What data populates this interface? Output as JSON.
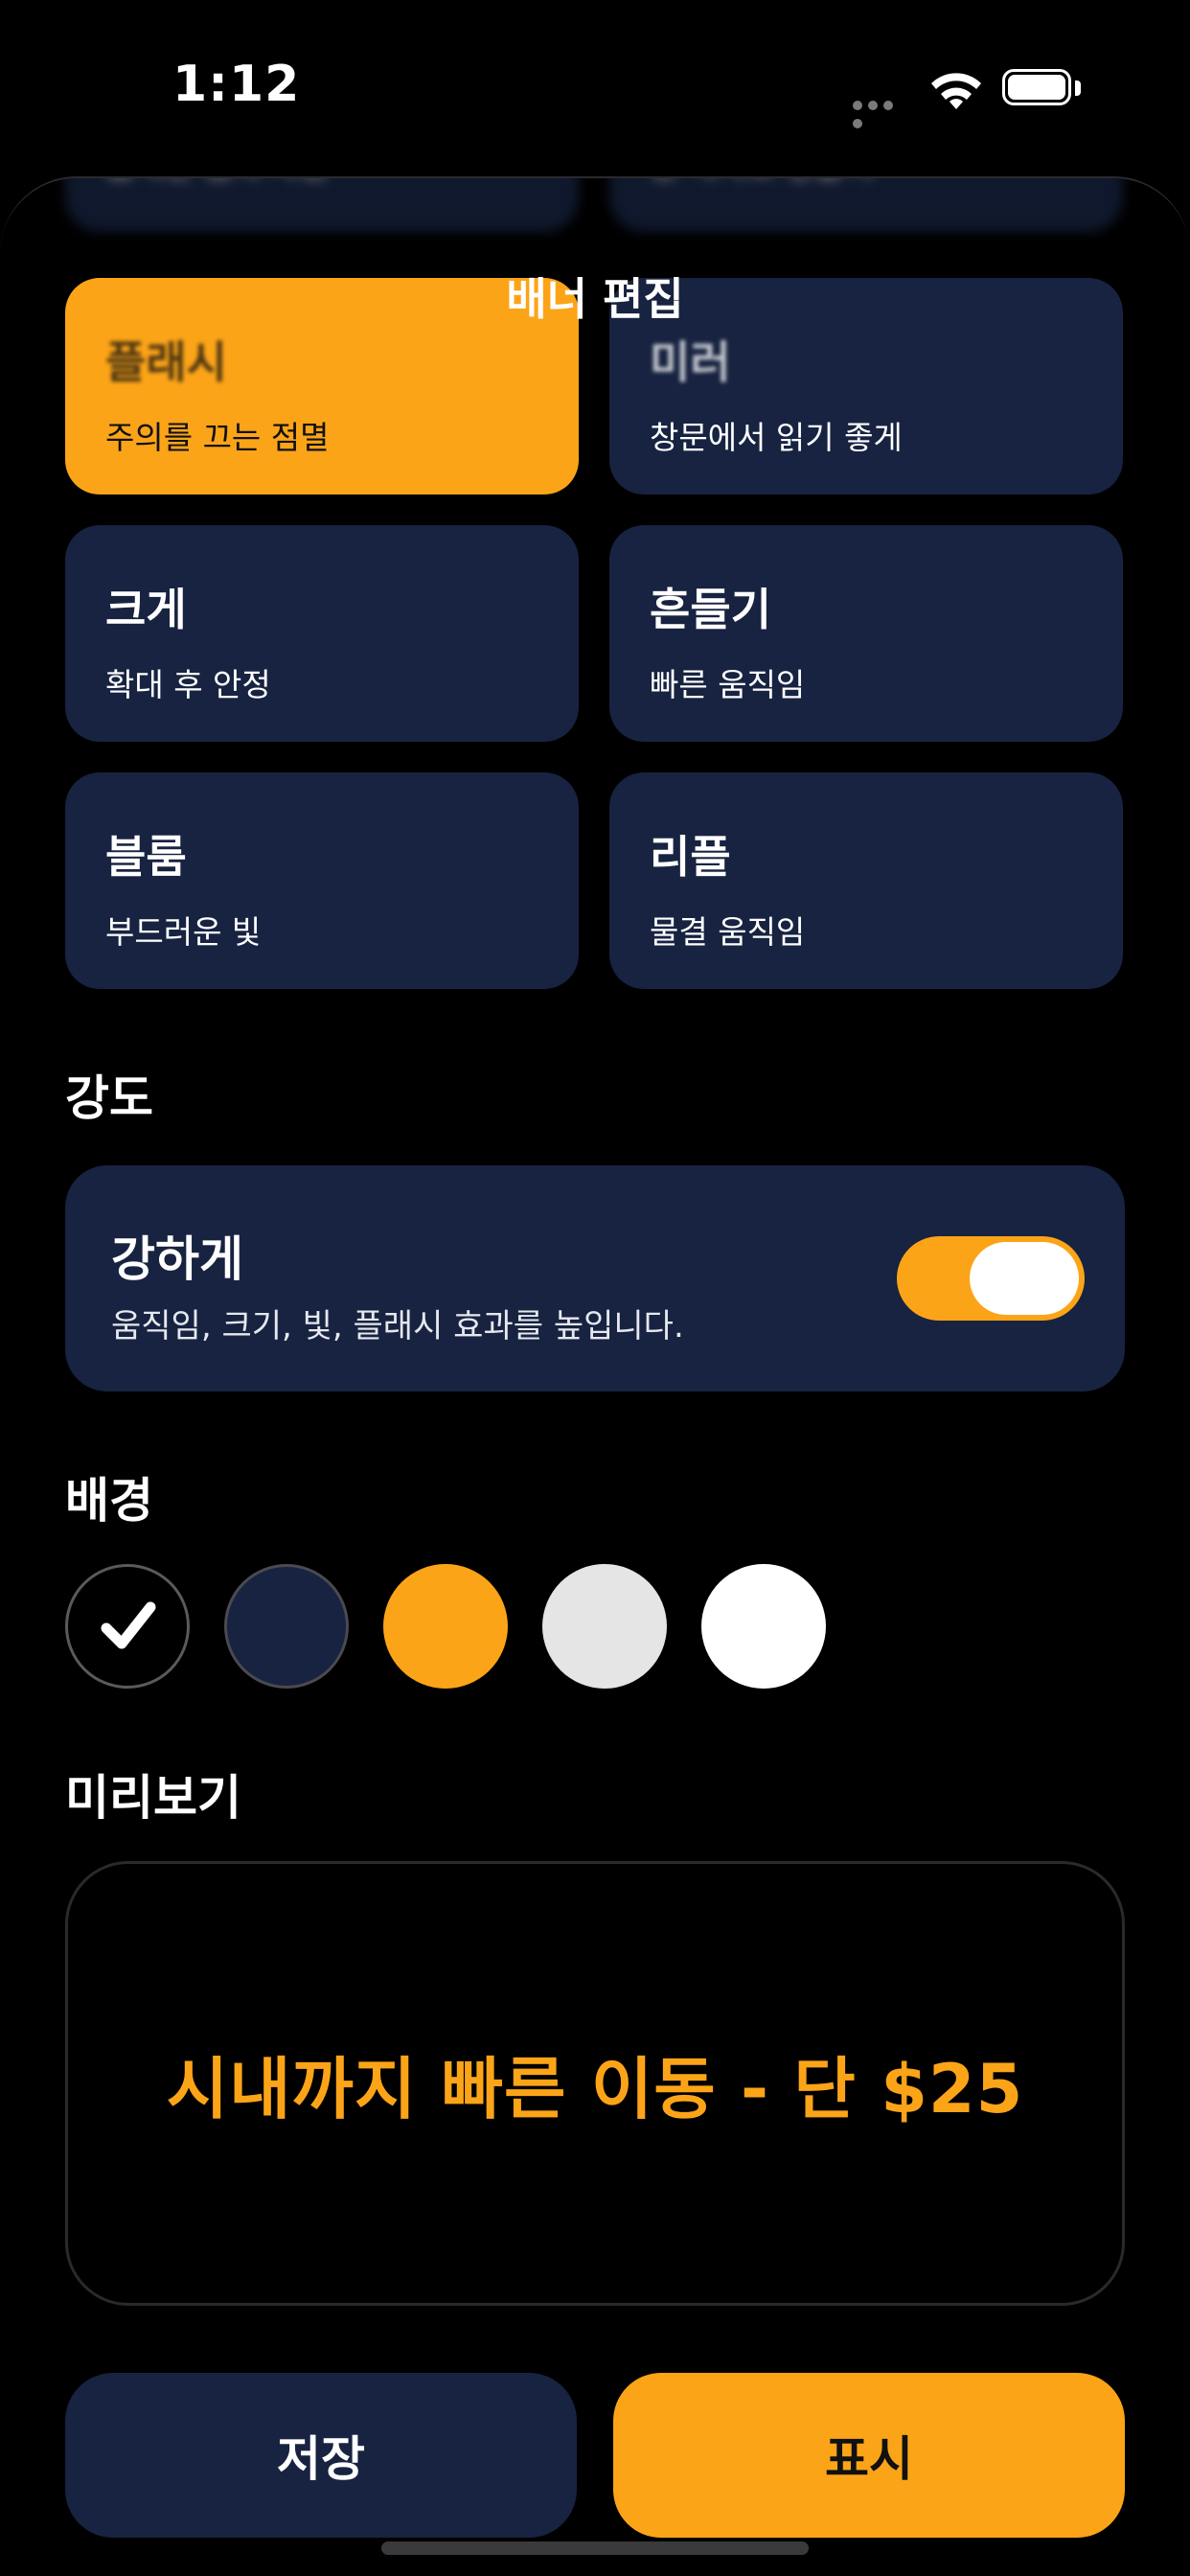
{
  "status_bar": {
    "time": "1:12"
  },
  "nav": {
    "title": "배너 편집"
  },
  "effects": {
    "top_partial": [
      {
        "title": "",
        "sub": "움직인 점의 차원"
      },
      {
        "title": "",
        "sub": "한 박자로 만들어"
      }
    ],
    "cards": [
      {
        "title": "플래시",
        "sub": "주의를 끄는 점멸",
        "selected": true
      },
      {
        "title": "미러",
        "sub": "창문에서 읽기 좋게",
        "selected": false
      },
      {
        "title": "크게",
        "sub": "확대 후 안정",
        "selected": false
      },
      {
        "title": "흔들기",
        "sub": "빠른 움직임",
        "selected": false
      },
      {
        "title": "블룸",
        "sub": "부드러운 빛",
        "selected": false
      },
      {
        "title": "리플",
        "sub": "물결 움직임",
        "selected": false
      }
    ]
  },
  "intensity": {
    "heading": "강도",
    "option_title": "강하게",
    "option_sub": "움직임, 크기, 빛, 플래시 효과를 높입니다.",
    "enabled": true
  },
  "background": {
    "heading": "배경",
    "swatches": [
      {
        "color": "#000000",
        "selected": true,
        "icon": "checkmark-icon"
      },
      {
        "color": "#172340",
        "selected": false
      },
      {
        "color": "#fca418",
        "selected": false
      },
      {
        "color": "#e5e5e5",
        "selected": false
      },
      {
        "color": "#ffffff",
        "selected": false
      }
    ]
  },
  "preview": {
    "heading": "미리보기",
    "banner_text": "시내까지 빠른 이동 - 단 $25"
  },
  "actions": {
    "save_label": "저장",
    "show_label": "표시"
  },
  "colors": {
    "accent": "#fca418",
    "card": "#172340",
    "background": "#000000"
  }
}
